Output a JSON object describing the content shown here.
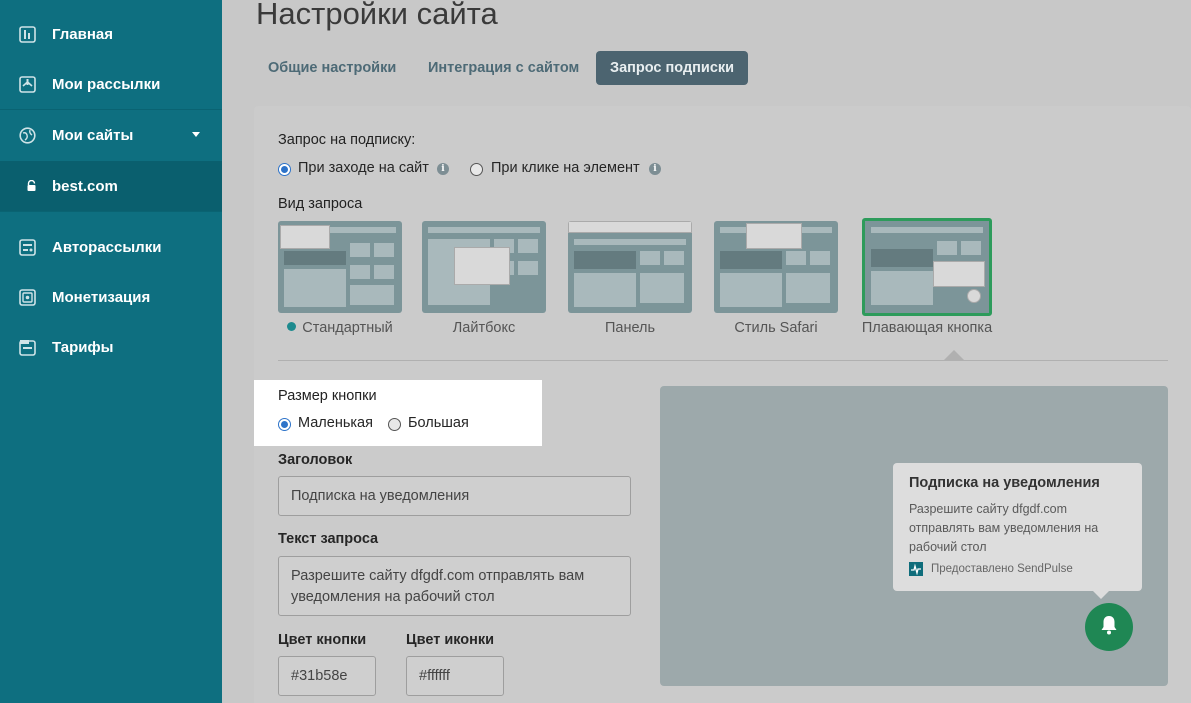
{
  "sidebar": {
    "items": [
      {
        "label": "Главная",
        "icon": "home-icon"
      },
      {
        "label": "Мои рассылки",
        "icon": "mail-icon"
      },
      {
        "label": "Мои сайты",
        "icon": "globe-icon"
      },
      {
        "label": "best.com",
        "icon": "lock-icon"
      },
      {
        "label": "Авторассылки",
        "icon": "automation-icon"
      },
      {
        "label": "Монетизация",
        "icon": "monetization-icon"
      },
      {
        "label": "Тарифы",
        "icon": "pricing-icon"
      }
    ]
  },
  "page": {
    "title": "Настройки сайта"
  },
  "tabs": [
    {
      "label": "Общие настройки"
    },
    {
      "label": "Интеграция с сайтом"
    },
    {
      "label": "Запрос подписки"
    }
  ],
  "subscription_request": {
    "label": "Запрос на подписку:",
    "options": [
      {
        "label": "При заходе на сайт",
        "selected": true
      },
      {
        "label": "При клике на элемент",
        "selected": false
      }
    ]
  },
  "request_type": {
    "label": "Вид запроса",
    "options": [
      {
        "label": "Стандартный"
      },
      {
        "label": "Лайтбокс"
      },
      {
        "label": "Панель"
      },
      {
        "label": "Стиль Safari"
      },
      {
        "label": "Плавающая кнопка"
      }
    ]
  },
  "button_size": {
    "label": "Размер кнопки",
    "options": [
      {
        "label": "Маленькая",
        "selected": true
      },
      {
        "label": "Большая",
        "selected": false
      }
    ]
  },
  "title_field": {
    "label": "Заголовок",
    "value": "Подписка на уведомления"
  },
  "text_field": {
    "label": "Текст запроса",
    "value": "Разрешите сайту dfgdf.com отправлять вам уведомления на рабочий стол"
  },
  "button_color": {
    "label": "Цвет кнопки",
    "value": "#31b58e"
  },
  "icon_color": {
    "label": "Цвет иконки",
    "value": "#ffffff"
  },
  "preview": {
    "title": "Подписка на уведомления",
    "body": "Разрешите сайту dfgdf.com отправлять вам уведомления на рабочий стол",
    "footer": "Предоставлено SendPulse"
  },
  "colors": {
    "sidebar": "#0e6f80",
    "accent_green": "#1f8754",
    "selected_border": "#2d9b5b"
  }
}
